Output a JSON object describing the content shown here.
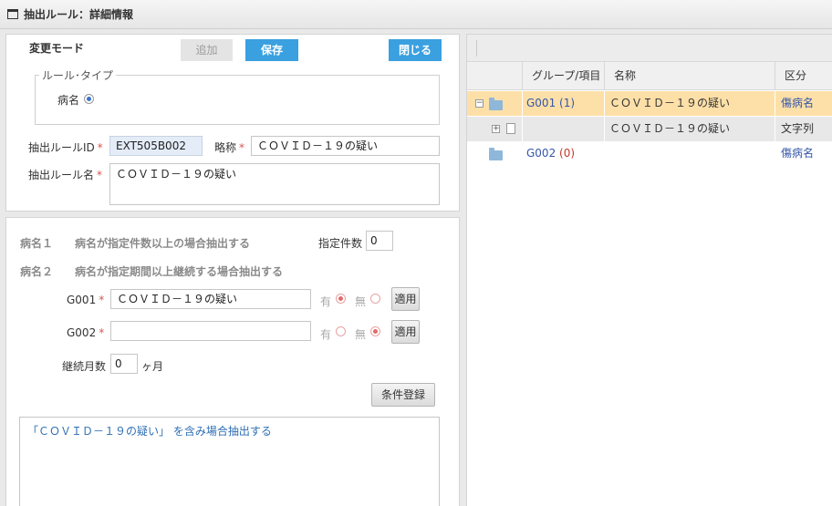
{
  "window": {
    "title": "抽出ルール：詳細情報"
  },
  "top": {
    "mode_label": "変更モード",
    "add_label": "追加",
    "save_label": "保存",
    "close_label": "閉じる",
    "rule_type_legend": "ルール･タイプ",
    "rule_type_option": "病名",
    "rule_id_label": "抽出ルールID",
    "rule_id_value": "EXT505B002",
    "abbrev_label": "略称",
    "abbrev_value": "ＣＯＶＩＤ－１９の疑い",
    "rule_name_label": "抽出ルール名",
    "rule_name_value": "ＣＯＶＩＤ－１９の疑い",
    "required_mark": "*"
  },
  "bottom": {
    "cond1_num": "病名１",
    "cond1_text": "病名が指定件数以上の場合抽出する",
    "count_label": "指定件数",
    "count_value": "0",
    "cond2_num": "病名２",
    "cond2_text": "病名が指定期間以上継続する場合抽出する",
    "g001_label": "G001",
    "g001_value": "ＣＯＶＩＤ－１９の疑い",
    "g002_label": "G002",
    "g002_value": "",
    "yes_label": "有",
    "no_label": "無",
    "apply_label": "適用",
    "months_label": "継続月数",
    "months_value": "0",
    "months_unit": "ヶ月",
    "register_label": "条件登録",
    "result_text": "「ＣＯＶＩＤ－１９の疑い」 を含み場合抽出する"
  },
  "grid": {
    "columns": [
      "グループ/項目",
      "名称",
      "区分"
    ],
    "rows": [
      {
        "code": "G001",
        "count": "(1)",
        "name": "ＣＯＶＩＤ－１９の疑い",
        "kubun": "傷病名"
      },
      {
        "code": "",
        "count": "",
        "name": "ＣＯＶＩＤ－１９の疑い",
        "kubun": "文字列"
      },
      {
        "code": "G002",
        "count": "(0)",
        "name": "",
        "kubun": "傷病名"
      }
    ]
  },
  "colors": {
    "accent": "#3aa0e0",
    "selected_row": "#fde0a8",
    "required": "#d9534f"
  }
}
